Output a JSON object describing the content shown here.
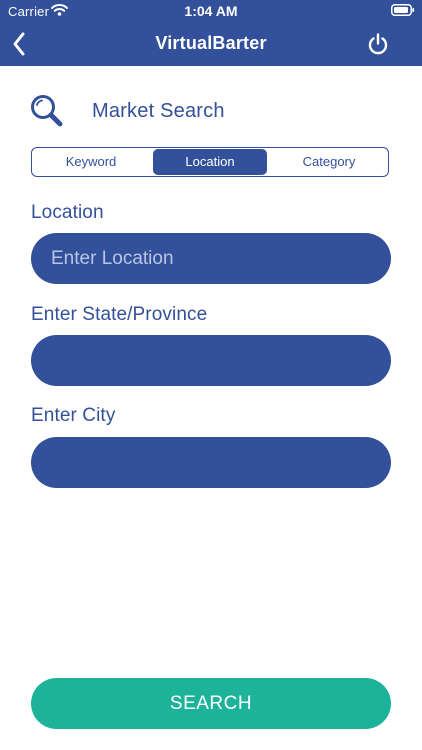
{
  "status_bar": {
    "carrier": "Carrier",
    "time": "1:04 AM"
  },
  "nav": {
    "title": "VirtualBarter",
    "back_icon": "chevron-left-icon",
    "power_icon": "power-icon"
  },
  "section": {
    "title": "Market Search",
    "icon": "search-icon"
  },
  "segments": [
    {
      "label": "Keyword",
      "selected": false
    },
    {
      "label": "Location",
      "selected": true
    },
    {
      "label": "Category",
      "selected": false
    }
  ],
  "form": {
    "location": {
      "label": "Location",
      "placeholder": "Enter Location",
      "value": ""
    },
    "state": {
      "label": "Enter State/Province",
      "placeholder": "",
      "value": ""
    },
    "city": {
      "label": "Enter City",
      "placeholder": "",
      "value": ""
    }
  },
  "search_button": {
    "label": "SEARCH"
  },
  "colors": {
    "primary": "#33509a",
    "accent": "#1cb39a",
    "background": "#ffffff"
  }
}
